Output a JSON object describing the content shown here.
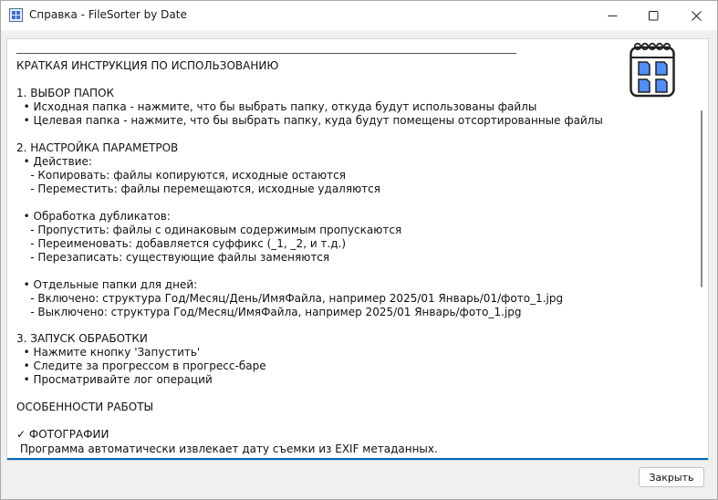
{
  "window": {
    "title": "Справка - FileSorter by Date"
  },
  "help": {
    "lines": [
      "КРАТКАЯ ИНСТРУКЦИЯ ПО ИСПОЛЬЗОВАНИЮ",
      "1. ВЫБОР ПАПОК",
      "  • Исходная папка - нажмите, что бы выбрать папку, откуда будут использованы файлы",
      "  • Целевая папка - нажмите, что бы выбрать папку, куда будут помещены отсортированные файлы",
      "2. НАСТРОЙКА ПАРАМЕТРОВ",
      "  • Действие:",
      "    - Копировать: файлы копируются, исходные остаются",
      "    - Переместить: файлы перемещаются, исходные удаляются",
      "  • Обработка дубликатов:",
      "    - Пропустить: файлы с одинаковым содержимым пропускаются",
      "    - Переименовать: добавляется суффикс (_1, _2, и т.д.)",
      "    - Перезаписать: существующие файлы заменяются",
      "  • Отдельные папки для дней:",
      "    - Включено: структура Год/Месяц/День/ИмяФайла, например 2025/01 Январь/01/фото_1.jpg",
      "    - Выключено: структура Год/Месяц/ИмяФайла, например 2025/01 Январь/фото_1.jpg",
      "3. ЗАПУСК ОБРАБОТКИ",
      "  • Нажмите кнопку 'Запустить'",
      "  • Следите за прогрессом в прогресс-баре",
      "  • Просматривайте лог операций",
      "ОСОБЕННОСТИ РАБОТЫ",
      "✓ ФОТОГРАФИИ",
      " Программа автоматически извлекает дату съемки из EXIF метаданных."
    ]
  },
  "footer": {
    "close_label": "Закрыть"
  },
  "icons": {
    "app": "app-icon",
    "calendar": "calendar-icon",
    "minimize": "minimize-icon",
    "maximize": "maximize-icon",
    "close": "close-icon"
  },
  "colors": {
    "accent": "#0067c0",
    "calendar_blue": "#4f8ff7"
  }
}
